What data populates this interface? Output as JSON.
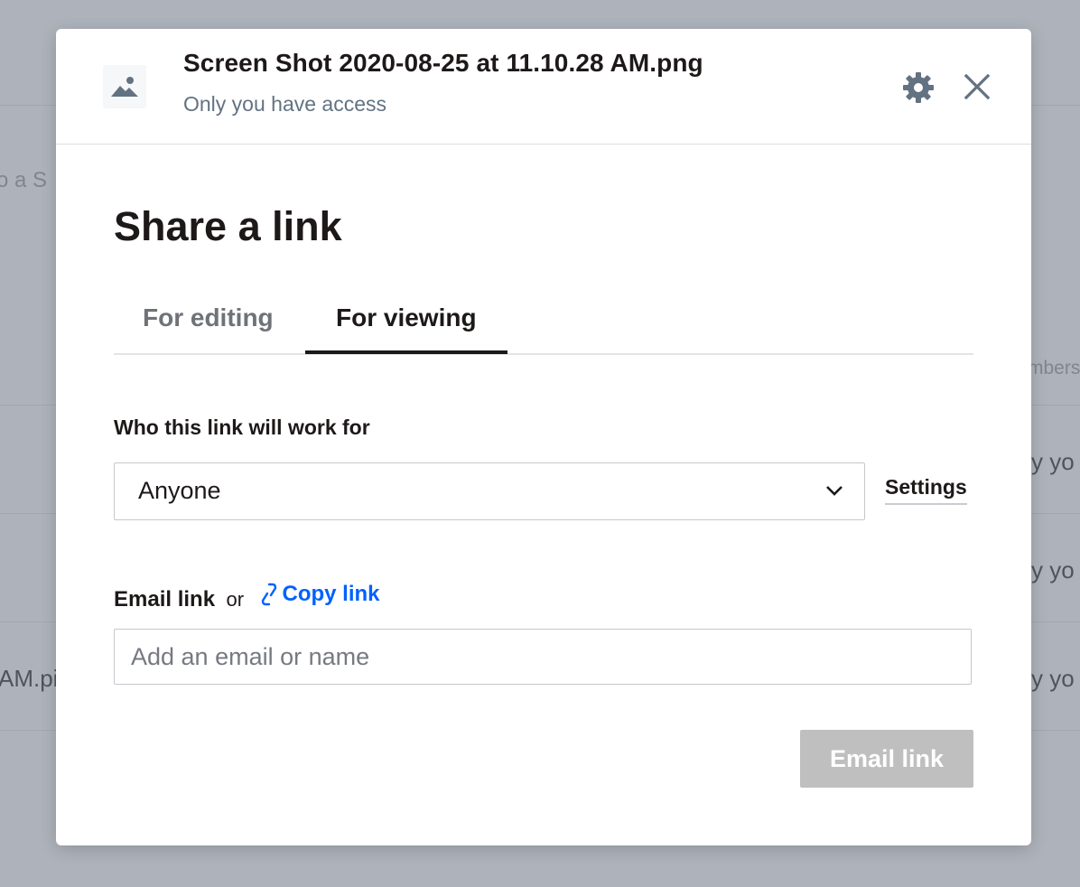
{
  "background": {
    "fragments": {
      "left_top": "o a S",
      "right_header": "mbers",
      "right_row1": "y yo",
      "right_row2": "y yo",
      "right_row3": "y yo",
      "left_row3": "AM.pi"
    }
  },
  "modal": {
    "file_name": "Screen Shot 2020-08-25 at 11.10.28 AM.png",
    "access": "Only you have access",
    "thumb_icon": "image-icon",
    "settings_icon": "gear-icon",
    "close_icon": "close-icon",
    "title": "Share a link",
    "tabs": [
      {
        "label": "For editing",
        "active": false
      },
      {
        "label": "For viewing",
        "active": true
      }
    ],
    "who_label": "Who this link will work for",
    "who_select": {
      "selected": "Anyone"
    },
    "settings_link": "Settings",
    "email_label": "Email link",
    "or_text": "or",
    "copy_link": "Copy link",
    "email_input": {
      "value": "",
      "placeholder": "Add an email or name"
    },
    "email_button": "Email link"
  },
  "colors": {
    "accent_link": "#0061fe",
    "overlay": "#aeb3bb",
    "disabled_button": "#bfbfbf"
  }
}
